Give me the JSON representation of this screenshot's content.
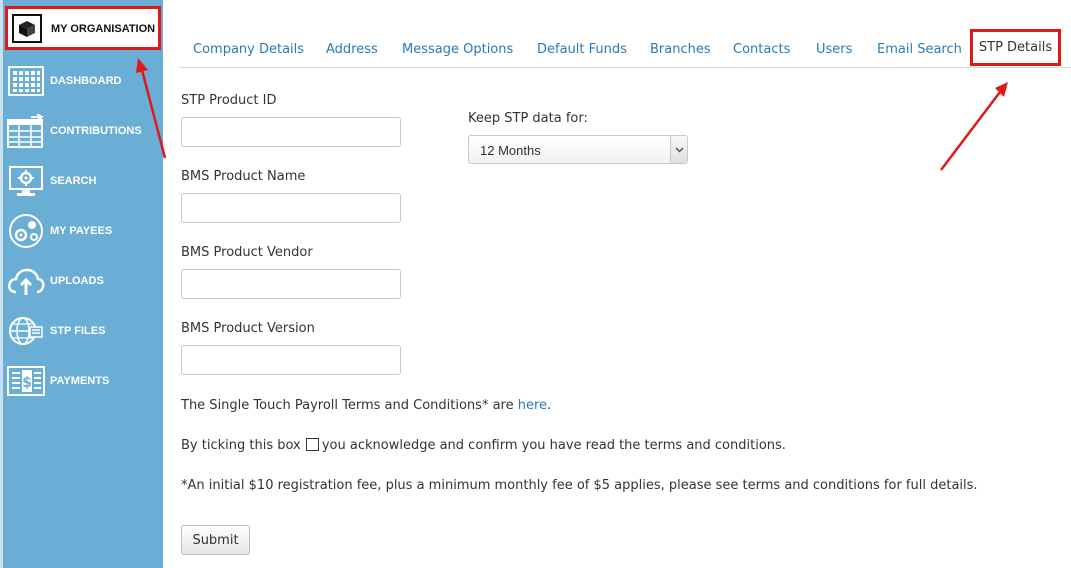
{
  "sidebar": {
    "organisation_label": "MY ORGANISATION",
    "items": [
      {
        "label": "DASHBOARD",
        "icon": "dashboard-icon"
      },
      {
        "label": "CONTRIBUTIONS",
        "icon": "contributions-icon"
      },
      {
        "label": "SEARCH",
        "icon": "search-icon"
      },
      {
        "label": "MY PAYEES",
        "icon": "payees-icon"
      },
      {
        "label": "UPLOADS",
        "icon": "upload-cloud-icon"
      },
      {
        "label": "STP FILES",
        "icon": "stp-files-icon"
      },
      {
        "label": "PAYMENTS",
        "icon": "payments-icon"
      }
    ]
  },
  "tabs": [
    "Company Details",
    "Address",
    "Message Options",
    "Default Funds",
    "Branches",
    "Contacts",
    "Users",
    "Email Search",
    "STP Details"
  ],
  "active_tab": "STP Details",
  "form": {
    "stp_product_id_label": "STP Product ID",
    "stp_product_id_value": "",
    "bms_product_name_label": "BMS Product Name",
    "bms_product_name_value": "",
    "bms_product_vendor_label": "BMS Product Vendor",
    "bms_product_vendor_value": "",
    "bms_product_version_label": "BMS Product Version",
    "bms_product_version_value": "",
    "keep_stp_label": "Keep STP data for:",
    "keep_stp_value": "12 Months"
  },
  "terms": {
    "intro": "The Single Touch Payroll Terms and Conditions* are ",
    "link": "here",
    "after_link": ".",
    "checkbox_before": "By ticking this box",
    "checkbox_after": "you acknowledge and confirm you have read the terms and conditions.",
    "checkbox_checked": false,
    "fee_note": "*An initial $10 registration fee, plus a minimum monthly fee of $5 applies, please see terms and conditions for full details."
  },
  "submit_label": "Submit",
  "colors": {
    "sidebar": "#6aaed6",
    "link": "#2a7ab8",
    "highlight": "#e01818"
  }
}
